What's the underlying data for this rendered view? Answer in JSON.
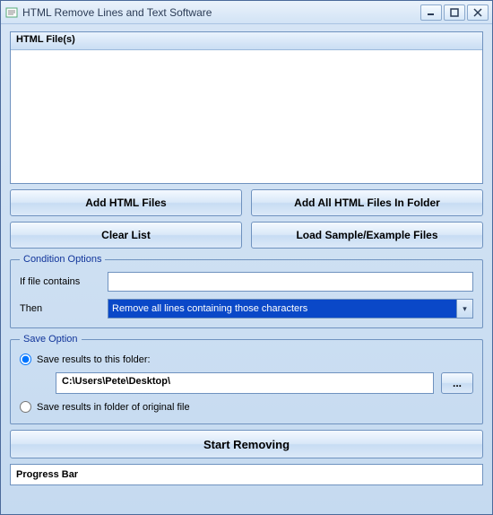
{
  "window": {
    "title": "HTML Remove Lines and Text Software"
  },
  "files": {
    "header": "HTML File(s)"
  },
  "buttons": {
    "add_files": "Add HTML Files",
    "add_folder": "Add All HTML Files In Folder",
    "clear": "Clear List",
    "load_sample": "Load Sample/Example Files",
    "start": "Start Removing",
    "browse": "..."
  },
  "condition": {
    "legend": "Condition Options",
    "contains_label": "If file contains",
    "contains_value": "",
    "then_label": "Then",
    "then_selected": "Remove all lines containing those characters"
  },
  "save": {
    "legend": "Save Option",
    "to_folder_label": "Save results to this folder:",
    "path": "C:\\Users\\Pete\\Desktop\\",
    "original_label": "Save results in folder of original file"
  },
  "progress": {
    "label": "Progress Bar"
  }
}
